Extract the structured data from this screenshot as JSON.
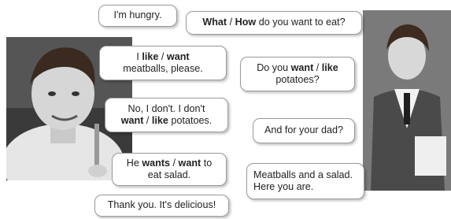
{
  "bubbles": {
    "b1": {
      "line1": "I'm hungry."
    },
    "b2": {
      "w1": "What",
      "sep": " / ",
      "w2": "How",
      "rest": " do you want to eat?"
    },
    "b3": {
      "pre": "I ",
      "w1": "like",
      "sep": " / ",
      "w2": "want",
      "line2": "meatballs, please."
    },
    "b4": {
      "pre": "Do you ",
      "w1": "want",
      "sep": " / ",
      "w2": "like",
      "line2": "potatoes?"
    },
    "b5": {
      "line1": "No, I don't. I don't",
      "w1": "want",
      "sep": " / ",
      "w2": "like",
      "rest": " potatoes."
    },
    "b6": {
      "line1": "And for your dad?"
    },
    "b7": {
      "pre": "He ",
      "w1": "wants",
      "sep": " / ",
      "w2": "want",
      "post": " to",
      "line2": "eat salad."
    },
    "b8": {
      "line1": "Meatballs and a salad.",
      "line2": "Here you are."
    },
    "b9": {
      "line1": "Thank you. It's delicious!"
    }
  }
}
